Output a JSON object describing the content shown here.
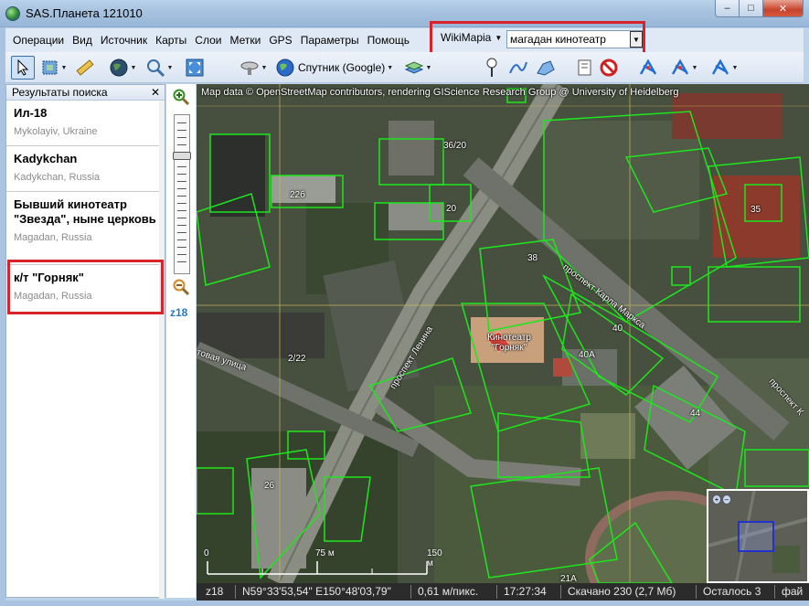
{
  "window": {
    "title": "SAS.Планета 121010"
  },
  "menu": {
    "items": [
      {
        "label": "Операции"
      },
      {
        "label": "Вид"
      },
      {
        "label": "Источник"
      },
      {
        "label": "Карты"
      },
      {
        "label": "Слои"
      },
      {
        "label": "Метки"
      },
      {
        "label": "GPS"
      },
      {
        "label": "Параметры"
      },
      {
        "label": "Помощь"
      }
    ],
    "search_provider": "WikiMapia",
    "search_value": "магадан кинотеатр"
  },
  "toolbar": {
    "map_source": "Спутник (Google)",
    "icons": [
      "cursor-icon",
      "layers-select-icon",
      "ruler-icon",
      "globe-icon",
      "zoom-tool-icon",
      "fullscreen-icon",
      "satellite-dish-icon",
      "globe-source-icon",
      "layers-icon",
      "placemark-icon",
      "path-icon",
      "polygon-icon",
      "notes-icon",
      "stop-icon",
      "gps-icon",
      "gps-track-icon",
      "gps-settings-icon"
    ]
  },
  "search_panel": {
    "title": "Результаты поиска",
    "results": [
      {
        "title": "Ил-18",
        "subtitle": "Mykolayiv, Ukraine"
      },
      {
        "title": "Kadykchan",
        "subtitle": "Kadykchan, Russia"
      },
      {
        "title": "Бывший кинотеатр \"Звезда\", ныне церковь",
        "subtitle": "Magadan, Russia"
      },
      {
        "title": "к/т \"Горняк\"",
        "subtitle": "Magadan, Russia"
      }
    ],
    "highlighted_index": 3
  },
  "zoom": {
    "level": "z18"
  },
  "map": {
    "attribution": "Map data © OpenStreetMap contributors, rendering GIScience Research Group @ University of Heidelberg",
    "labels": {
      "b_3620": "36/20",
      "b_22b": "22б",
      "b_20": "20",
      "b_35": "35",
      "b_38": "38",
      "street_marx": "проспект Карла Маркса",
      "street_lenin": "проспект Ленина",
      "street_other": "товая улица",
      "street_right": "проспект К",
      "b_40": "40",
      "b_40a": "40А",
      "b_44": "44",
      "b_222": "2/22",
      "b_26": "26",
      "b_21a": "21А",
      "cinema": "Кинотеатр \"Горняк\""
    },
    "scale": {
      "zero": "0",
      "mid": "75 м",
      "max": "150 м"
    }
  },
  "statusbar": {
    "zoom": "z18",
    "coords": "N59°33'53,54\" E150°48'03,79\"",
    "resolution": "0,61 м/пикс.",
    "time": "17:27:34",
    "downloaded": "Скачано 230 (2,7 Мб)",
    "remaining": "Осталось 3",
    "files": "фай"
  }
}
